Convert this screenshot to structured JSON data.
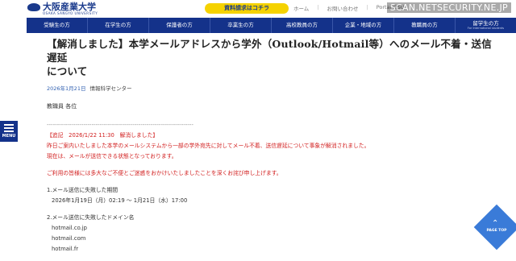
{
  "header": {
    "logo_text": "大阪産業大学",
    "logo_sub": "OSAKA SANGYO UNIVERSITY",
    "request_button": "資料請求はコチラ",
    "top_links": [
      "ホーム",
      "お問い合わせ",
      "Portal OSU"
    ],
    "site_label": "SCAN.NETSECURITY.NE.JP"
  },
  "nav": {
    "items": [
      {
        "label": "受験生の方",
        "sub": ""
      },
      {
        "label": "在学生の方",
        "sub": ""
      },
      {
        "label": "保護者の方",
        "sub": ""
      },
      {
        "label": "卒業生の方",
        "sub": ""
      },
      {
        "label": "高校教員の方",
        "sub": ""
      },
      {
        "label": "企業・地域の方",
        "sub": ""
      },
      {
        "label": "教職員の方",
        "sub": ""
      },
      {
        "label": "留学生の方",
        "sub": "For International students"
      }
    ],
    "menu_label": "MENU"
  },
  "article": {
    "title_line1": "【解消しました】本学メールアドレスから学外（Outlook/Hotmail等）へのメール不着・送信遅延",
    "title_line2": "について",
    "date": "2026年1月21日",
    "department": "情報科学センター",
    "salutation": "教職員 各位",
    "divider": "------------------------------------------------------------------------",
    "notice_header": "【追記　2026/1/22 11:30　解消しました】",
    "notice_line1": "昨日ご案内いたしました本学のメールシステムから一部の学外宛先に対してメール不着、送信遅延について事象が解消されました。",
    "notice_line2": "現在は、メールが送信できる状態となっております。",
    "apology": "ご利用の皆様には多大なご不便とご迷惑をおかけいたしましたことを深くお詫び申し上げます。",
    "section1_title": "1.メール送信に失敗した期間",
    "section1_period": "2026年1月19日（月）02:19 ～ 1月21日（水）17:00",
    "section2_title": "2.メール送信に失敗したドメイン名",
    "domains": [
      "hotmail.co.jp",
      "hotmail.com",
      "hotmail.fr"
    ]
  },
  "page_top": {
    "label": "PAGE TOP"
  },
  "colors": {
    "navy": "#14328a",
    "accent_yellow": "#f5d200",
    "notice_red": "#d22020",
    "page_top_blue": "#3a7bd8"
  }
}
